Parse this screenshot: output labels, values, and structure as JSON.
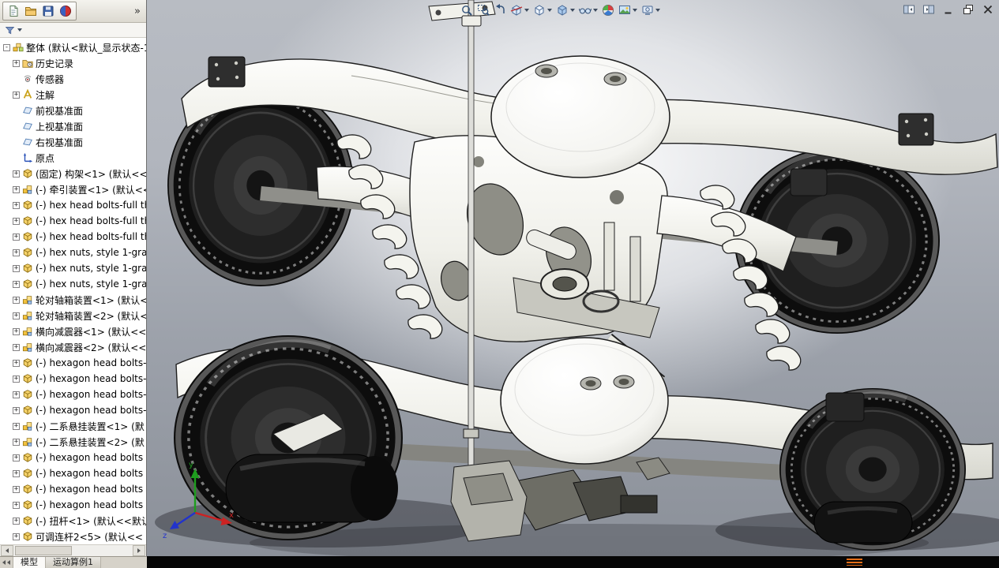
{
  "app": {
    "collapse_chevron": "»"
  },
  "toolbars": {
    "standard": [
      {
        "name": "new-document-icon"
      },
      {
        "name": "open-document-icon"
      },
      {
        "name": "save-icon"
      },
      {
        "name": "help-icon"
      }
    ],
    "filter": {
      "name": "filter-icon"
    },
    "headsup": [
      {
        "name": "zoom-fit-icon",
        "dropdown": false
      },
      {
        "name": "zoom-area-icon",
        "dropdown": false
      },
      {
        "name": "previous-view-icon",
        "dropdown": false
      },
      {
        "name": "section-view-icon",
        "dropdown": true
      },
      {
        "name": "view-orientation-icon",
        "dropdown": true
      },
      {
        "name": "display-style-icon",
        "dropdown": true
      },
      {
        "name": "hide-show-items-icon",
        "dropdown": true
      },
      {
        "name": "edit-appearance-icon",
        "dropdown": false
      },
      {
        "name": "apply-scene-icon",
        "dropdown": true
      },
      {
        "name": "view-settings-icon",
        "dropdown": true
      }
    ],
    "window_controls": [
      {
        "name": "collapse-pane-icon"
      },
      {
        "name": "expand-pane-icon"
      },
      {
        "name": "minimize-icon"
      },
      {
        "name": "restore-icon"
      },
      {
        "name": "close-icon"
      }
    ]
  },
  "feature_tree": {
    "items": [
      {
        "label": "整体 (默认<默认_显示状态-1",
        "icon": "assembly-root-icon",
        "expand": "-",
        "indent": 0
      },
      {
        "label": "历史记录",
        "icon": "history-icon",
        "expand": "+",
        "indent": 1
      },
      {
        "label": "传感器",
        "icon": "sensors-icon",
        "expand": "",
        "indent": 1
      },
      {
        "label": "注解",
        "icon": "annotations-icon",
        "expand": "+",
        "indent": 1
      },
      {
        "label": "前视基准面",
        "icon": "plane-icon",
        "expand": "",
        "indent": 1
      },
      {
        "label": "上视基准面",
        "icon": "plane-icon",
        "expand": "",
        "indent": 1
      },
      {
        "label": "右视基准面",
        "icon": "plane-icon",
        "expand": "",
        "indent": 1
      },
      {
        "label": "原点",
        "icon": "origin-icon",
        "expand": "",
        "indent": 1
      },
      {
        "label": "(固定) 构架<1> (默认<<",
        "icon": "part-icon",
        "expand": "+",
        "indent": 1
      },
      {
        "label": "(-) 牵引装置<1> (默认<<",
        "icon": "assembly-icon",
        "expand": "+",
        "indent": 1
      },
      {
        "label": "(-) hex head bolts-full th",
        "icon": "part-icon",
        "expand": "+",
        "indent": 1
      },
      {
        "label": "(-) hex head bolts-full th",
        "icon": "part-icon",
        "expand": "+",
        "indent": 1
      },
      {
        "label": "(-) hex head bolts-full th",
        "icon": "part-icon",
        "expand": "+",
        "indent": 1
      },
      {
        "label": "(-) hex nuts, style 1-gra",
        "icon": "part-icon",
        "expand": "+",
        "indent": 1
      },
      {
        "label": "(-) hex nuts, style 1-gra",
        "icon": "part-icon",
        "expand": "+",
        "indent": 1
      },
      {
        "label": "(-) hex nuts, style 1-gra",
        "icon": "part-icon",
        "expand": "+",
        "indent": 1
      },
      {
        "label": "轮对轴箱装置<1> (默认<",
        "icon": "assembly-icon",
        "expand": "+",
        "indent": 1
      },
      {
        "label": "轮对轴箱装置<2> (默认<",
        "icon": "assembly-icon",
        "expand": "+",
        "indent": 1
      },
      {
        "label": "横向减震器<1> (默认<<",
        "icon": "assembly-icon",
        "expand": "+",
        "indent": 1
      },
      {
        "label": "横向减震器<2> (默认<<",
        "icon": "assembly-icon",
        "expand": "+",
        "indent": 1
      },
      {
        "label": "(-) hexagon head bolts-",
        "icon": "part-icon",
        "expand": "+",
        "indent": 1
      },
      {
        "label": "(-) hexagon head bolts-",
        "icon": "part-icon",
        "expand": "+",
        "indent": 1
      },
      {
        "label": "(-) hexagon head bolts-",
        "icon": "part-icon",
        "expand": "+",
        "indent": 1
      },
      {
        "label": "(-) hexagon head bolts-",
        "icon": "part-icon",
        "expand": "+",
        "indent": 1
      },
      {
        "label": "(-) 二系悬挂装置<1> (默",
        "icon": "assembly-icon",
        "expand": "+",
        "indent": 1
      },
      {
        "label": "(-) 二系悬挂装置<2> (默",
        "icon": "assembly-icon",
        "expand": "+",
        "indent": 1
      },
      {
        "label": "(-) hexagon head bolts",
        "icon": "part-icon",
        "expand": "+",
        "indent": 1
      },
      {
        "label": "(-) hexagon head bolts",
        "icon": "part-icon",
        "expand": "+",
        "indent": 1
      },
      {
        "label": "(-) hexagon head bolts",
        "icon": "part-icon",
        "expand": "+",
        "indent": 1
      },
      {
        "label": "(-) hexagon head bolts",
        "icon": "part-icon",
        "expand": "+",
        "indent": 1
      },
      {
        "label": "(-) 扭杆<1> (默认<<默认",
        "icon": "part-icon",
        "expand": "+",
        "indent": 1
      },
      {
        "label": "可调连杆2<5> (默认<<",
        "icon": "part-icon",
        "expand": "+",
        "indent": 1
      }
    ]
  },
  "viewport": {
    "triad": {
      "x_label": "x",
      "y_label": "y",
      "z_label": "z",
      "x_color": "#cc2222",
      "y_color": "#1e9e1e",
      "z_color": "#2233cc"
    }
  },
  "statusbar": {
    "tabs": [
      {
        "label": "模型",
        "active": true
      },
      {
        "label": "运动算例1",
        "active": false
      }
    ]
  },
  "colors": {
    "accent": "#3c5a80",
    "watermark": "#ff7a1a"
  }
}
